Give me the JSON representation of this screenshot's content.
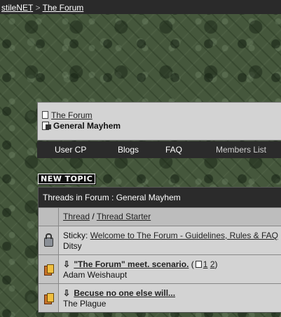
{
  "topbar": {
    "site": "stileNET",
    "separator": ">",
    "forum": "The Forum"
  },
  "breadcrumb": {
    "parent": "The Forum",
    "current": "General Mayhem"
  },
  "navbar": {
    "usercp": "User CP",
    "blogs": "Blogs",
    "faq": "FAQ",
    "members": "Members List"
  },
  "new_topic_label": "NEW TOPIC",
  "table": {
    "title": "Threads in Forum : General Mayhem",
    "header": {
      "thread": "Thread",
      "slash": " / ",
      "starter": "Thread Starter"
    },
    "rows": [
      {
        "prefix": "Sticky:",
        "title": "Welcome to The Forum - Guidelines, Rules & FAQ",
        "starter": "Ditsy"
      },
      {
        "title": "\"The Forum\" meet. scenario.",
        "pages_open": "(",
        "page1": "1",
        "page2": "2",
        "pages_close": ")",
        "starter": "Adam Weishaupt"
      },
      {
        "title": "Becuse no one else will...",
        "starter": "The Plague"
      }
    ]
  }
}
